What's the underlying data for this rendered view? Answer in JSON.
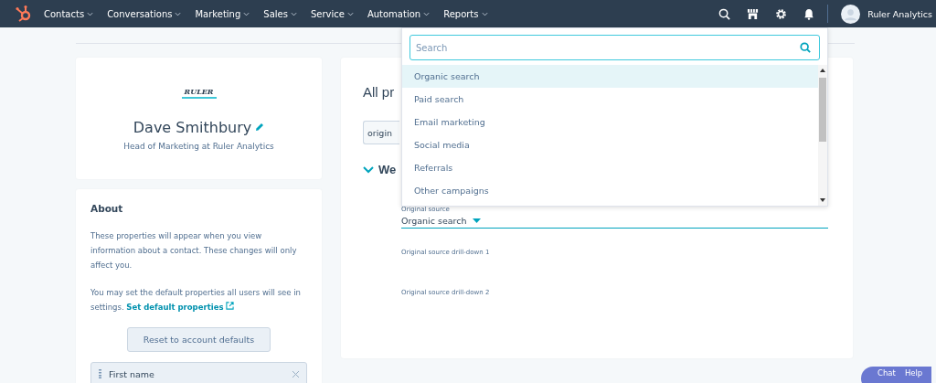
{
  "nav": {
    "items": [
      {
        "label": "Contacts"
      },
      {
        "label": "Conversations"
      },
      {
        "label": "Marketing"
      },
      {
        "label": "Sales"
      },
      {
        "label": "Service"
      },
      {
        "label": "Automation"
      },
      {
        "label": "Reports"
      }
    ],
    "account": "Ruler Analytics"
  },
  "profile": {
    "logo": "RULER",
    "name": "Dave Smithbury",
    "title": "Head of Marketing at Ruler Analytics"
  },
  "about": {
    "title": "About",
    "text": "These properties will appear when you view information about a contact. These changes will only affect you.",
    "note": "You may set the default properties all users will see in settings.",
    "link": "Set default properties",
    "button": "Reset to account defaults",
    "properties": [
      {
        "label": "First name"
      }
    ]
  },
  "main": {
    "title": "All pr",
    "filter": "origin",
    "section": {
      "title": "We",
      "expanded": true
    },
    "fields": [
      {
        "kind": "select",
        "label": "Original source",
        "value": "Organic search"
      },
      {
        "kind": "empty",
        "label": "Original source drill-down 1"
      },
      {
        "kind": "empty",
        "label": "Original source drill-down 2"
      }
    ]
  },
  "dropdown": {
    "placeholder": "Search",
    "options": [
      {
        "label": "Organic search",
        "selected": true
      },
      {
        "label": "Paid search",
        "selected": false
      },
      {
        "label": "Email marketing",
        "selected": false
      },
      {
        "label": "Social media",
        "selected": false
      },
      {
        "label": "Referrals",
        "selected": false
      },
      {
        "label": "Other campaigns",
        "selected": false
      }
    ]
  },
  "chat": {
    "labels": [
      "Chat",
      "Help"
    ]
  }
}
